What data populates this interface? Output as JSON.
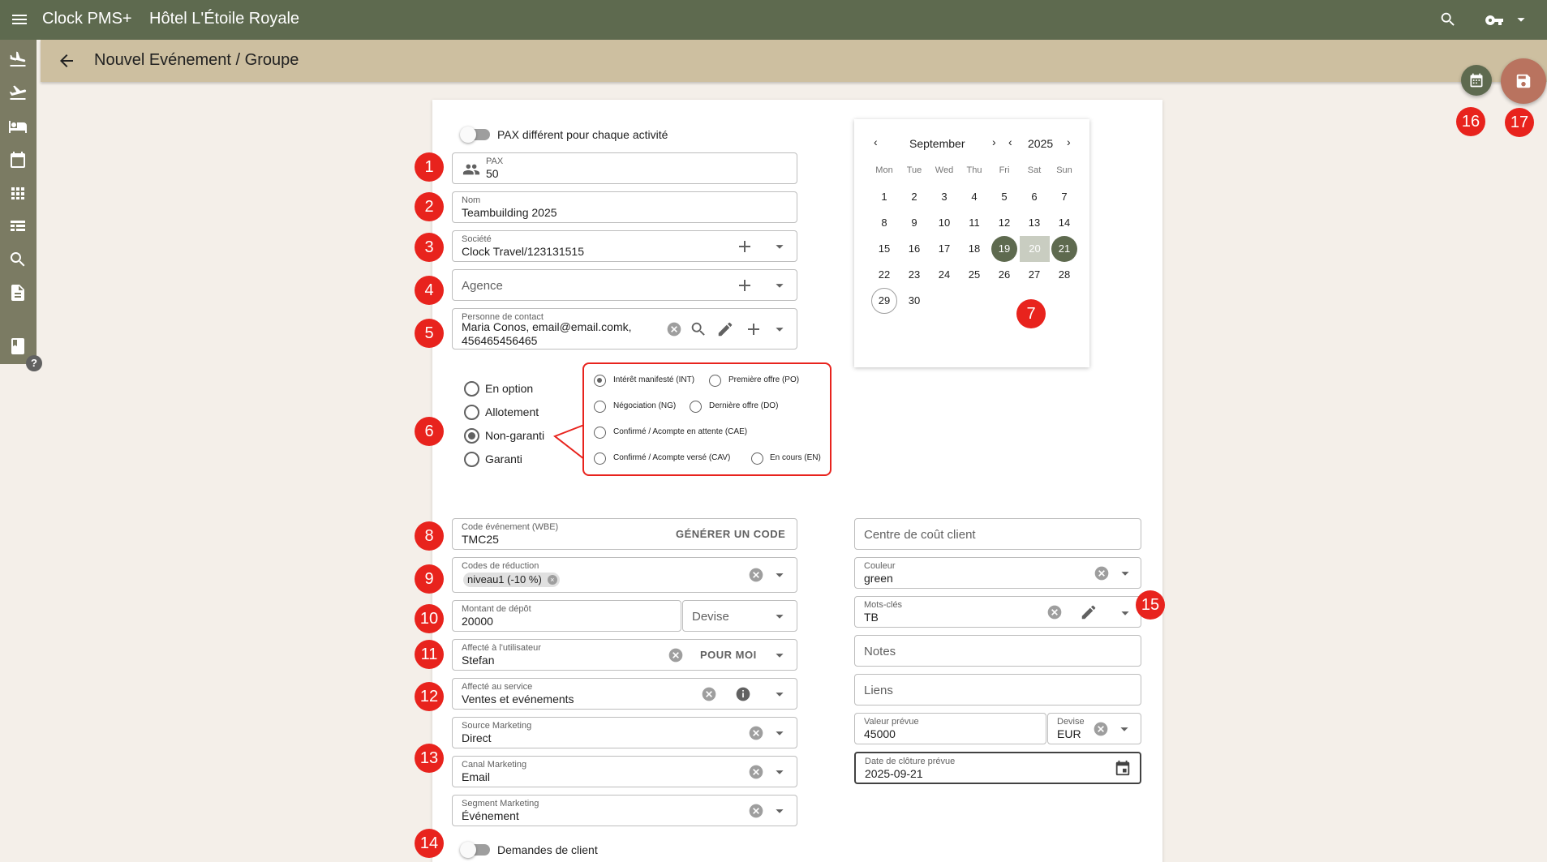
{
  "topbar": {
    "app_name": "Clock PMS+",
    "hotel_name": "Hôtel L'Étoile Royale"
  },
  "subheader": {
    "title": "Nouvel Evénement / Groupe"
  },
  "badges": [
    "1",
    "2",
    "3",
    "4",
    "5",
    "6",
    "7",
    "8",
    "9",
    "10",
    "11",
    "12",
    "13",
    "14",
    "15",
    "16",
    "17"
  ],
  "form": {
    "pax_toggle_label": "PAX différent pour chaque activité",
    "pax": {
      "label": "PAX",
      "value": "50"
    },
    "nom": {
      "label": "Nom",
      "value": "Teambuilding 2025"
    },
    "societe": {
      "label": "Société",
      "value": "Clock Travel/123131515"
    },
    "agence": {
      "placeholder": "Agence"
    },
    "contact": {
      "label": "Personne de contact",
      "line1": "Maria Conos, email@email.comk,",
      "line2": "456465456465"
    },
    "status_options": [
      "En option",
      "Allotement",
      "Non-garanti",
      "Garanti"
    ],
    "status_selected": "Non-garanti",
    "sub_status": [
      {
        "label": "Intérêt manifesté (INT)",
        "selected": true
      },
      {
        "label": "Première offre (PO)",
        "selected": false
      },
      {
        "label": "Négociation (NG)",
        "selected": false
      },
      {
        "label": "Dernière offre (DO)",
        "selected": false
      },
      {
        "label": "Confirmé / Acompte en attente (CAE)",
        "selected": false
      },
      {
        "label": "Confirmé / Acompte versé (CAV)",
        "selected": false
      },
      {
        "label": "En cours (EN)",
        "selected": false
      }
    ],
    "code_evenement": {
      "label": "Code événement (WBE)",
      "value": "TMC25",
      "button": "GÉNÉRER UN CODE"
    },
    "codes_reduction": {
      "label": "Codes de réduction",
      "chip": "niveau1 (-10 %)"
    },
    "montant_depot": {
      "label": "Montant de dépôt",
      "value": "20000"
    },
    "devise_depot": {
      "placeholder": "Devise"
    },
    "affecte_utilisateur": {
      "label": "Affecté à l'utilisateur",
      "value": "Stefan",
      "button": "POUR MOI"
    },
    "affecte_service": {
      "label": "Affecté au service",
      "value": "Ventes et evénements"
    },
    "source_marketing": {
      "label": "Source Marketing",
      "value": "Direct"
    },
    "canal_marketing": {
      "label": "Canal Marketing",
      "value": "Email"
    },
    "segment_marketing": {
      "label": "Segment Marketing",
      "value": "Événement"
    },
    "demandes_toggle_label": "Demandes de client",
    "centre_cout": {
      "placeholder": "Centre de coût client"
    },
    "couleur": {
      "label": "Couleur",
      "value": "green"
    },
    "mots_cles": {
      "label": "Mots-clés",
      "value": "TB"
    },
    "notes": {
      "placeholder": "Notes"
    },
    "liens": {
      "placeholder": "Liens"
    },
    "valeur_prevue": {
      "label": "Valeur prévue",
      "value": "45000"
    },
    "devise_valeur": {
      "label": "Devise",
      "value": "EUR"
    },
    "date_cloture": {
      "label": "Date de clôture prévue",
      "value": "2025-09-21"
    }
  },
  "calendar": {
    "month": "September",
    "year": "2025",
    "weekdays": [
      "Mon",
      "Tue",
      "Wed",
      "Thu",
      "Fri",
      "Sat",
      "Sun"
    ],
    "days": [
      "1",
      "2",
      "3",
      "4",
      "5",
      "6",
      "7",
      "8",
      "9",
      "10",
      "11",
      "12",
      "13",
      "14",
      "15",
      "16",
      "17",
      "18",
      "19",
      "20",
      "21",
      "22",
      "23",
      "24",
      "25",
      "26",
      "27",
      "28",
      "29",
      "30"
    ],
    "range_start": "19",
    "range_end": "21",
    "today": "29"
  },
  "colors": {
    "topbar": "#5e6a4f",
    "subheader": "#cdbfa0",
    "badge": "#e8231d",
    "save_fab": "#b9735f"
  },
  "icons": [
    "menu-icon",
    "search-icon",
    "key-icon",
    "chevron-down-icon",
    "arrow-back-icon",
    "group-icon",
    "add-icon",
    "clear-icon",
    "edit-icon",
    "info-icon",
    "calendar-icon",
    "save-icon",
    "help-icon"
  ]
}
